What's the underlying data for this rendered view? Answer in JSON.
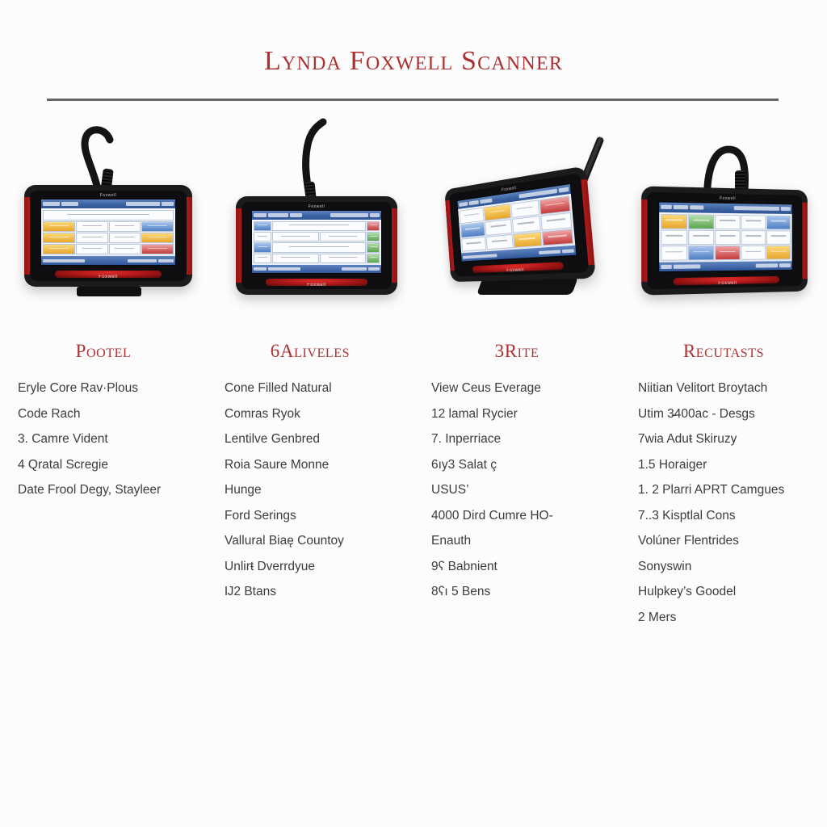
{
  "page": {
    "title": "Lynda Foxwell Scanner",
    "background_color": "#fcfcfc",
    "accent_color": "#ae3232",
    "rule_color": "#636466",
    "body_text_color": "#3c3c3c"
  },
  "columns": [
    {
      "heading": "Pootel",
      "device": {
        "name": "obd2-scanner-front-view",
        "screen_label": "diagnostic-menu-grid",
        "brand_top": "Foxwell",
        "brand_bottom": "Foxwell"
      },
      "lines": [
        "Eryle Core Rav·Plous",
        "Code Rach",
        "3. Camre Vident",
        "4 Qratal Scregie",
        "Date Frool Deɡy, Stayleer"
      ]
    },
    {
      "heading": "6Aliveles",
      "device": {
        "name": "obd2-scanner-angled-cable",
        "screen_label": "vehicle-info-screen",
        "brand_top": "Foxwell",
        "brand_bottom": "Foxwell"
      },
      "lines": [
        "Cone Filled Natural",
        "Comras Ryok",
        "Lentilve Genbred",
        "Roia Saure Monne",
        "Hunge",
        "Ford Serings",
        "Vallural Biaę Countoy",
        "Unlirŧ Dverrdyue",
        "Ĳ2 Btans"
      ]
    },
    {
      "heading": "3Rite",
      "device": {
        "name": "obd2-scanner-perspective-stand",
        "screen_label": "wide-function-grid",
        "brand_top": "Foxwell",
        "brand_bottom": "Foxwell"
      },
      "lines": [
        "View Ceus Everage",
        "12 lamal Rycier",
        "7. Inperriace",
        "6ıy3 Salat ç",
        "USUS’",
        "4000 Dird Cumre HO-",
        "Enauth",
        "9ʕ Babnient",
        "8ʕı 5 Bens"
      ]
    },
    {
      "heading": "Recutasts",
      "device": {
        "name": "obd2-scanner-tilted-view",
        "screen_label": "icon-menu-grid",
        "brand_top": "Foxwell",
        "brand_bottom": "Foxwell"
      },
      "lines": [
        "Niitian Velitort Broytach",
        "Utim 3̵400ac - Desgs",
        "7wia Aduŧ Skiruzy",
        "1.5 Horaiger",
        "1. 2 Plarri APRT Camgues",
        "7..3 Kisptlal Cons",
        "Volúner Flentrides",
        "Sonyswin",
        "Hulpkey’s Goodel",
        "2 Mers"
      ]
    }
  ]
}
